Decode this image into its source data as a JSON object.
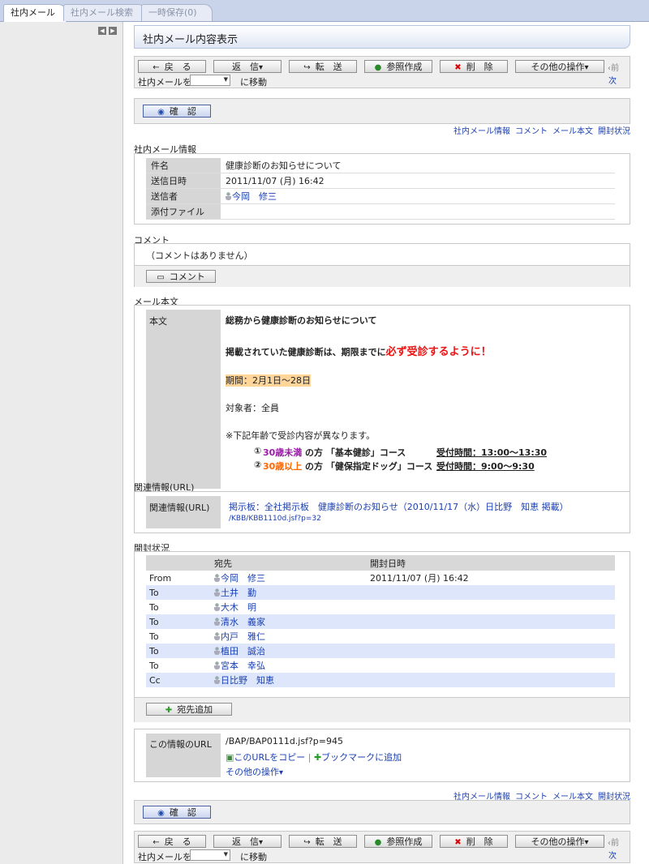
{
  "tabs": [
    {
      "label": "社内メール"
    },
    {
      "label": "社内メール検索"
    },
    {
      "label": "一時保存(0)"
    }
  ],
  "page_title": "社内メール内容表示",
  "toolbar": {
    "back": "戻　る",
    "reply": "返　信",
    "forward": "転　送",
    "ref_create": "参照作成",
    "delete": "削　除",
    "other": "その他の操作",
    "prev": "前",
    "next": "次",
    "move_prefix": "社内メールを",
    "move_suffix": "に移動"
  },
  "confirm_label": "確　認",
  "nav_links": [
    "社内メール情報",
    "コメント",
    "メール本文",
    "開封状況"
  ],
  "info_section": {
    "heading": "社内メール情報",
    "rows": [
      {
        "key": "件名",
        "value": "健康診断のお知らせについて"
      },
      {
        "key": "送信日時",
        "value": "2011/11/07 (月) 16:42"
      },
      {
        "key": "送信者",
        "value": "今岡　修三"
      },
      {
        "key": "添付ファイル",
        "value": ""
      }
    ]
  },
  "comment_section": {
    "heading": "コメント",
    "empty": "（コメントはありません）",
    "button": "コメント"
  },
  "body_section": {
    "heading": "メール本文",
    "key": "本文",
    "line1": "総務から健康診断のお知らせについて",
    "line2a": "掲載されていた健康診断は、期限までに",
    "line2b": "必ず受診するように！",
    "period": "期間：2月1日～28日",
    "target": "対象者：全員",
    "note": "※下記年齢で受診内容が異なります。",
    "row1_num": "①",
    "row1_age": "30歳未満",
    "row1_course": "の方 「基本健診」コース",
    "row1_time": "受付時間：13:00～13:30",
    "row2_num": "②",
    "row2_age": "30歳以上",
    "row2_course": "の方 「健保指定ドッグ」コース",
    "row2_time": "受付時間：9:00～9:30"
  },
  "related_section": {
    "heading": "関連情報(URL)",
    "key": "関連情報(URL)",
    "link_text": "掲示板：全社掲示板　健康診断のお知らせ（2010/11/17（水）日比野　知恵 掲載）",
    "link_url": "/KBB/KBB1110d.jsf?p=32"
  },
  "status_section": {
    "heading": "開封状況",
    "col_to": "宛先",
    "col_date": "開封日時",
    "rows": [
      {
        "type": "From",
        "name": "今岡　修三",
        "date": "2011/11/07 (月) 16:42"
      },
      {
        "type": "To",
        "name": "土井　勤",
        "date": ""
      },
      {
        "type": "To",
        "name": "大木　明",
        "date": ""
      },
      {
        "type": "To",
        "name": "清水　義家",
        "date": ""
      },
      {
        "type": "To",
        "name": "内戸　雅仁",
        "date": ""
      },
      {
        "type": "To",
        "name": "植田　誠治",
        "date": ""
      },
      {
        "type": "To",
        "name": "宮本　幸弘",
        "date": ""
      },
      {
        "type": "Cc",
        "name": "日比野　知恵",
        "date": ""
      }
    ],
    "add_button": "宛先追加"
  },
  "url_section": {
    "key": "この情報のURL",
    "url": "/BAP/BAP0111d.jsf?p=945",
    "copy": "このURLをコピー",
    "bookmark": "ブックマークに追加",
    "other": "その他の操作"
  },
  "colors": {
    "accent_red": "#ee1111",
    "age_purple": "#9b1aa8",
    "age_orange": "#ff6600",
    "period_bg": "#ffd59a",
    "alt_row": "#dde6fb"
  }
}
